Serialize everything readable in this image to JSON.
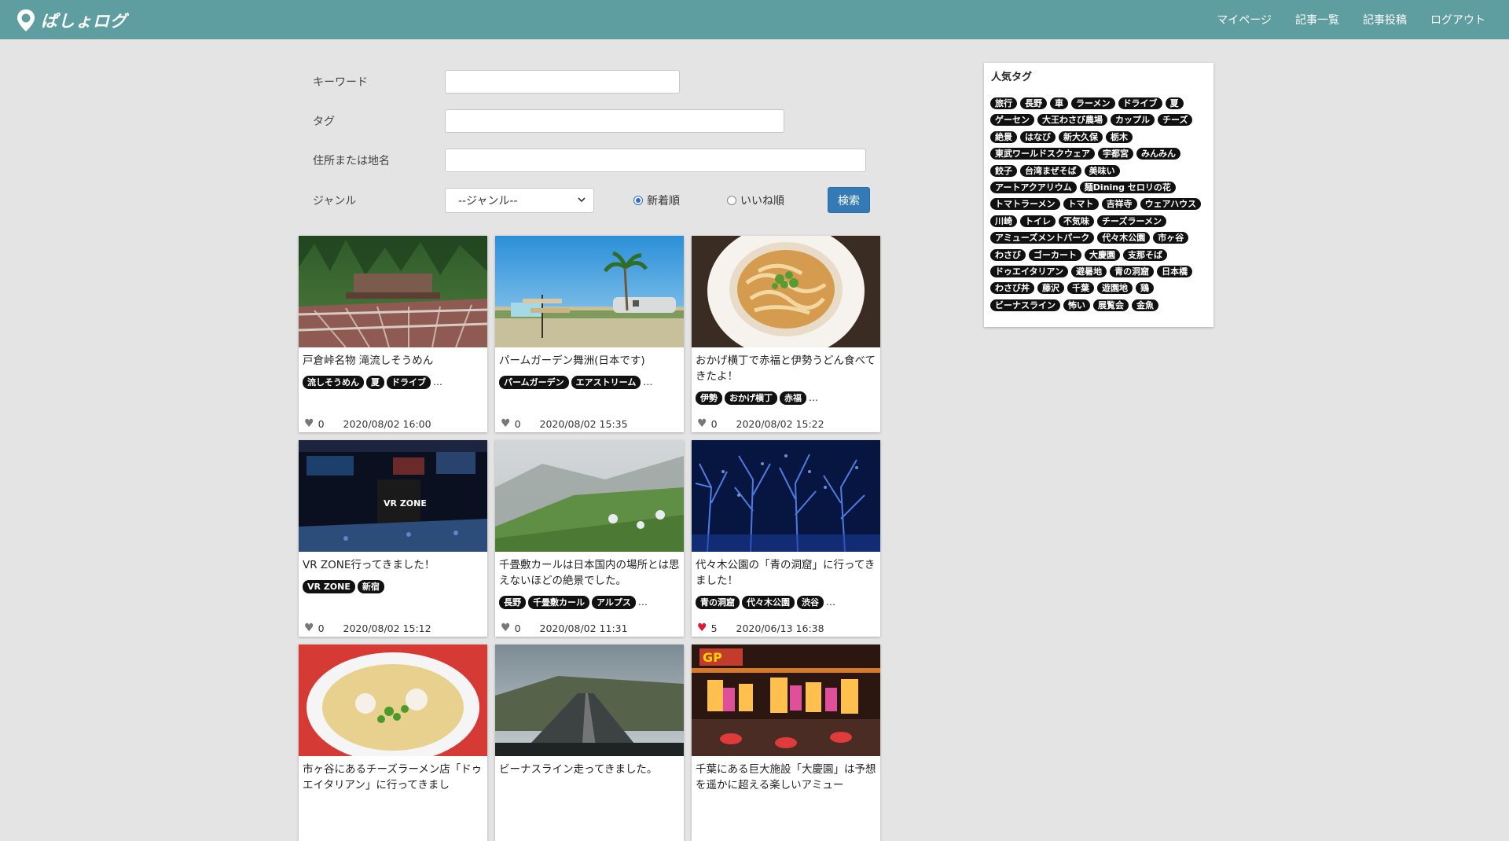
{
  "header": {
    "logo_text": "ぱしょログ",
    "nav": [
      "マイページ",
      "記事一覧",
      "記事投稿",
      "ログアウト"
    ]
  },
  "search": {
    "keyword_label": "キーワード",
    "tag_label": "タグ",
    "address_label": "住所または地名",
    "genre_label": "ジャンル",
    "genre_selected": "--ジャンル--",
    "sort_new": "新着順",
    "sort_likes": "いいね順",
    "sort_selected": "new",
    "button": "検索"
  },
  "popular_tags": {
    "title": "人気タグ",
    "tags": [
      "旅行",
      "長野",
      "車",
      "ラーメン",
      "ドライブ",
      "夏",
      "ゲーセン",
      "大王わさび農場",
      "カップル",
      "チーズ",
      "絶景",
      "はなび",
      "新大久保",
      "栃木",
      "東武ワールドスクウェア",
      "宇都宮",
      "みんみん",
      "餃子",
      "台湾まぜそば",
      "美味い",
      "アートアクアリウム",
      "麺Dining セロリの花",
      "トマトラーメン",
      "トマト",
      "吉祥寺",
      "ウェアハウス",
      "川崎",
      "トイレ",
      "不気味",
      "チーズラーメン",
      "アミューズメントパーク",
      "代々木公園",
      "市ヶ谷",
      "わさび",
      "ゴーカート",
      "大慶園",
      "支那そば",
      "ドゥエイタリアン",
      "避暑地",
      "青の洞窟",
      "日本橋",
      "わさび丼",
      "藤沢",
      "千葉",
      "遊園地",
      "鶏",
      "ビーナスライン",
      "怖い",
      "展覧会",
      "金魚"
    ]
  },
  "posts": [
    {
      "title": "戸倉峠名物 滝流しそうめん",
      "tags": [
        "流しそうめん",
        "夏",
        "ドライブ"
      ],
      "more": "…",
      "likes": "0",
      "date": "2020/08/02 16:00",
      "liked": false,
      "image": "forest"
    },
    {
      "title": "パームガーデン舞洲(日本です)",
      "tags": [
        "パームガーデン",
        "エアストリーム"
      ],
      "more": "…",
      "likes": "0",
      "date": "2020/08/02 15:35",
      "liked": false,
      "image": "beach"
    },
    {
      "title": "おかげ横丁で赤福と伊勢うどん食べてきたよ！",
      "tags": [
        "伊勢",
        "おかげ横丁",
        "赤福"
      ],
      "more": "…",
      "likes": "0",
      "date": "2020/08/02 15:22",
      "liked": false,
      "image": "udon"
    },
    {
      "title": "VR ZONE行ってきました！",
      "tags": [
        "VR ZONE",
        "新宿"
      ],
      "more": "",
      "likes": "0",
      "date": "2020/08/02 15:12",
      "liked": false,
      "image": "vrzone"
    },
    {
      "title": "千畳敷カールは日本国内の場所とは思えないほどの絶景でした。",
      "tags": [
        "長野",
        "千畳敷カール",
        "アルプス"
      ],
      "more": "…",
      "likes": "0",
      "date": "2020/08/02 11:31",
      "liked": false,
      "image": "mountain"
    },
    {
      "title": "代々木公園の「青の洞窟」に行ってきました！",
      "tags": [
        "青の洞窟",
        "代々木公園",
        "渋谷"
      ],
      "more": "…",
      "likes": "5",
      "date": "2020/06/13 16:38",
      "liked": true,
      "image": "bluecave"
    },
    {
      "title": "市ヶ谷にあるチーズラーメン店「ドゥエイタリアン」に行ってきまし",
      "tags": [],
      "more": "",
      "likes": "",
      "date": "",
      "liked": false,
      "image": "ramen"
    },
    {
      "title": "ビーナスライン走ってきました。",
      "tags": [],
      "more": "",
      "likes": "",
      "date": "",
      "liked": false,
      "image": "road"
    },
    {
      "title": "千葉にある巨大施設「大慶園」は予想を遥かに超える楽しいアミュー",
      "tags": [],
      "more": "",
      "likes": "",
      "date": "",
      "liked": false,
      "image": "arcade"
    }
  ]
}
